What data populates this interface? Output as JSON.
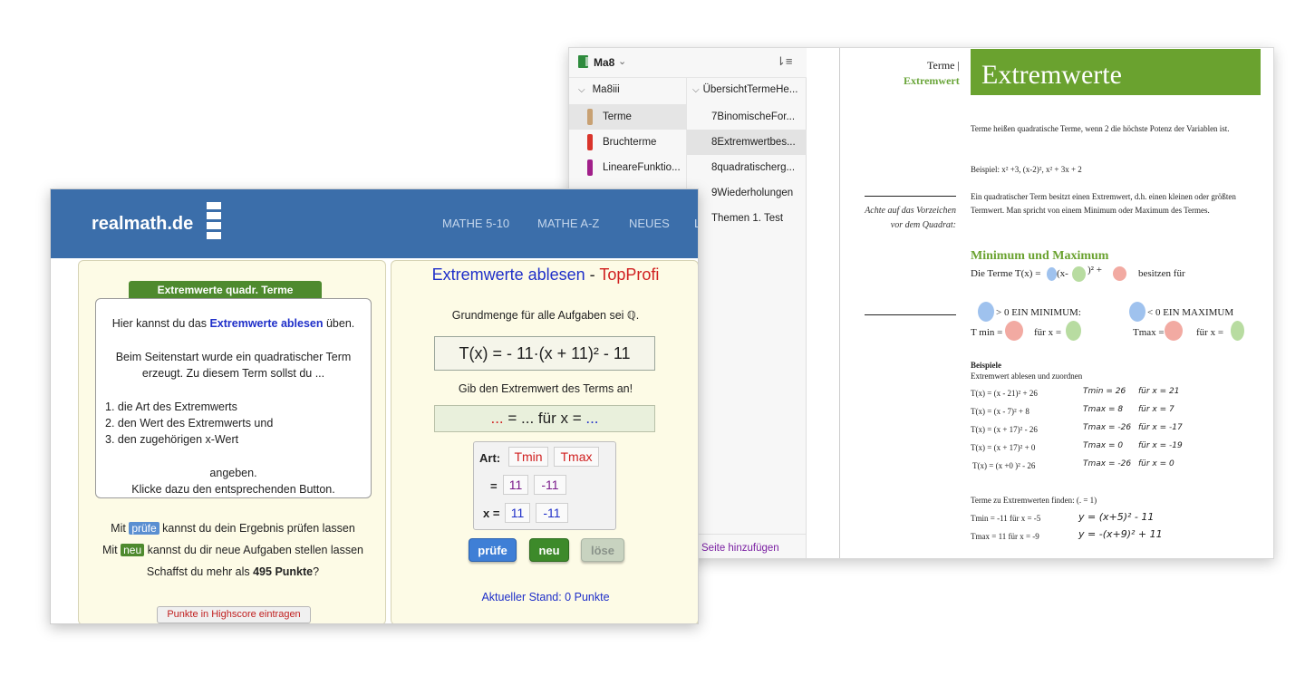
{
  "onenote": {
    "notebook": "Ma8",
    "section_group": "Ma8iii",
    "sections": [
      {
        "label": "Terme",
        "color": "#c8a173"
      },
      {
        "label": "Bruchterme",
        "color": "#d9342b"
      },
      {
        "label": "LineareFunktio...",
        "color": "#a1208a"
      }
    ],
    "page_group": "ÜbersichtTermeHe...",
    "pages": [
      "7BinomischeFor...",
      "8Extremwertbes...",
      "8quadratischerg...",
      "9Wiederholungen",
      "Themen 1. Test"
    ],
    "add_page": "Seite hinzufügen",
    "breadcrumb_1": "Terme |",
    "breadcrumb_2": "Extremwert",
    "title": "Extremwerte",
    "p1": "Terme heißen quadratische Terme, wenn 2 die höchste Potenz der Variablen ist.",
    "p2": "Beispiel: x² +3, (x-2)², x² + 3x + 2",
    "p3": "Ein quadratischer Term besitzt einen Extremwert, d.h. einen kleinen oder größten Termwert. Man spricht von einem Minimum oder Maximum des Termes.",
    "note": "Achte auf das Vorzeichen vor dem Quadrat:",
    "subhead": "Minimum und Maximum",
    "terme_line": "Die Terme T(x) =",
    "terme_x": "(x-",
    "terme_sq": ")²  +",
    "terme_besitzen": "besitzen für",
    "min_text": "> 0 EIN MINIMUM:",
    "max_text": "< 0 EIN MAXIMUM",
    "tmin": "T min =",
    "fuer_x": "für x =",
    "tmax": "Tmax =",
    "bsp_head": "Beispiele",
    "bsp_sub": "Extremwert ablesen und zuordnen",
    "examples": [
      {
        "term": "T(x) = (x - 21)² + 26",
        "t": "Tmin = 26",
        "x": "für x = 21"
      },
      {
        "term": "T(x) = (x - 7)² + 8",
        "t": "Tmax = 8",
        "x": "für x = 7"
      },
      {
        "term": "T(x) = (x + 17)² - 26",
        "t": "Tmax = -26",
        "x": "für x = -17"
      },
      {
        "term": "T(x) = (x + 17)² + 0",
        "t": "Tmax = 0",
        "x": "für x = -19"
      },
      {
        "term": "T(x) = (x +0 )² - 26",
        "t": "Tmax = -26",
        "x": "für x = 0"
      }
    ],
    "find_head": "Terme zu Extremwerten finden: (.    = 1)",
    "find_1": "Tmin = -11 für x = -5",
    "find_1_h": "y = (x+5)² - 11",
    "find_2": "Tmax =  11 für x = -9",
    "find_2_h": "y = -(x+9)² + 11"
  },
  "realmath": {
    "logo": "realmath.de",
    "nav": [
      "MATHE 5-10",
      "MATHE A-Z",
      "NEUES",
      "L"
    ],
    "info_tab": "Extremwerte quadr. Terme",
    "info_1a": "Hier kannst du das ",
    "info_1b": "Extremwerte ablesen",
    "info_1c": " üben.",
    "info_2": "Beim Seitenstart wurde ein quadratischer Term",
    "info_3": "erzeugt. Zu diesem Term sollst du ...",
    "list": [
      "1.  die Art des Extremwerts",
      "2.  den Wert des Extremwerts und",
      "3.  den zugehörigen x-Wert"
    ],
    "info_4": "angeben.",
    "info_5": "Klicke dazu den entsprechenden Button.",
    "mit": "Mit",
    "pruefe_tag": "prüfe",
    "pruefe_text": "kannst du dein Ergebnis prüfen lassen",
    "neu_tag": "neu",
    "neu_text": "kannst du dir neue Aufgaben stellen lassen",
    "schaffst_a": "Schaffst du mehr als ",
    "schaffst_b": "495 Punkte",
    "schaffst_c": "?",
    "highscore": "Punkte in Highscore eintragen",
    "title_1": "Extremwerte ablesen",
    "title_2": " - ",
    "title_3": "TopProfi",
    "grundmenge": "Grundmenge für alle Aufgaben sei ℚ.",
    "term": "T(x) = - 11·(x + 11)² - 11",
    "gib": "Gib den Extremwert des Terms an!",
    "ans_1": "...",
    "ans_2": " = ... für x = ",
    "ans_3": "...",
    "art_label": "Art:",
    "tmin": "Tmin",
    "tmax": "Tmax",
    "eq_label": "=",
    "val_a": "11",
    "val_b": "-11",
    "x_label": "x =",
    "x_a": "11",
    "x_b": "-11",
    "btn_pruefe": "prüfe",
    "btn_neu": "neu",
    "btn_loese": "löse",
    "stand": "Aktueller Stand: 0 Punkte"
  }
}
